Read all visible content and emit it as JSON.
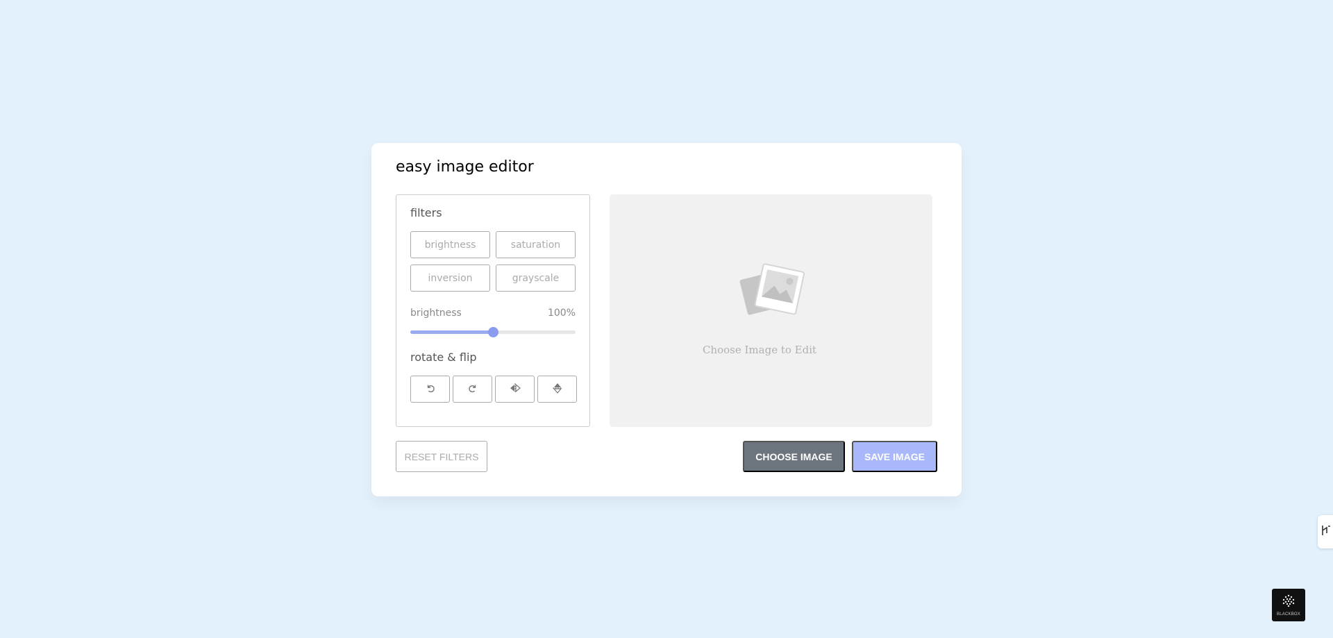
{
  "app": {
    "title": "easy image editor"
  },
  "filters": {
    "heading": "filters",
    "options": [
      "brightness",
      "saturation",
      "inversion",
      "grayscale"
    ],
    "active_filter_name": "brightness",
    "active_filter_value": "100%",
    "slider_fraction": 0.5,
    "accent_color": "#8a9bf0"
  },
  "rotate": {
    "heading": "rotate & flip",
    "buttons": [
      {
        "icon": "rotate-left-icon"
      },
      {
        "icon": "rotate-right-icon"
      },
      {
        "icon": "flip-horizontal-icon"
      },
      {
        "icon": "flip-vertical-icon"
      }
    ]
  },
  "preview": {
    "placeholder_text": "Choose Image to Edit",
    "icon": "image-placeholder-icon"
  },
  "actions": {
    "reset_label": "Reset Filters",
    "choose_label": "Choose Image",
    "save_label": "Save Image"
  },
  "badge": {
    "label": "BLACKBOX"
  }
}
